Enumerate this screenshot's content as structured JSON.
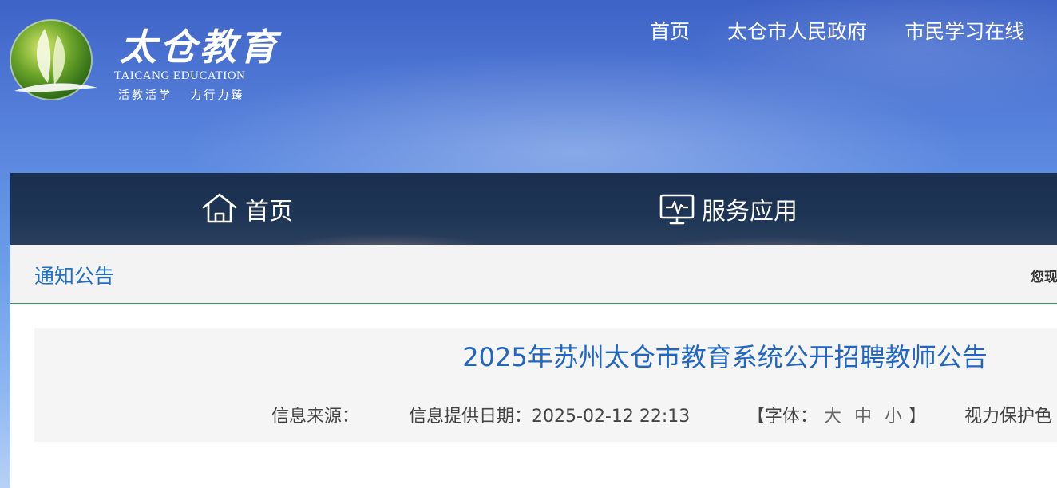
{
  "header": {
    "logo_title": "太仓教育",
    "logo_en": "TAICANG EDUCATION",
    "logo_slogan": "活教活学   力行力臻",
    "top_links": [
      "首页",
      "太仓市人民政府",
      "市民学习在线"
    ]
  },
  "nav": {
    "home_icon": "house-icon",
    "home_label": "首页",
    "service_icon": "monitor-pulse-icon",
    "service_label": "服务应用"
  },
  "breadcrumb": {
    "section": "通知公告",
    "location_prefix": "您现"
  },
  "article": {
    "title": "2025年苏州太仓市教育系统公开招聘教师公告",
    "source_label": "信息来源：",
    "date_label": "信息提供日期：",
    "date_value": "2025-02-12 22:13",
    "font_open": "【字体：",
    "font_large": "大",
    "font_medium": "中",
    "font_small": "小",
    "font_close": "】",
    "eye_care": "视力保护色"
  },
  "colors": {
    "accent_blue": "#1f6ec7",
    "nav_bg": "#1e3556",
    "divider_green": "#2e9e4a"
  }
}
